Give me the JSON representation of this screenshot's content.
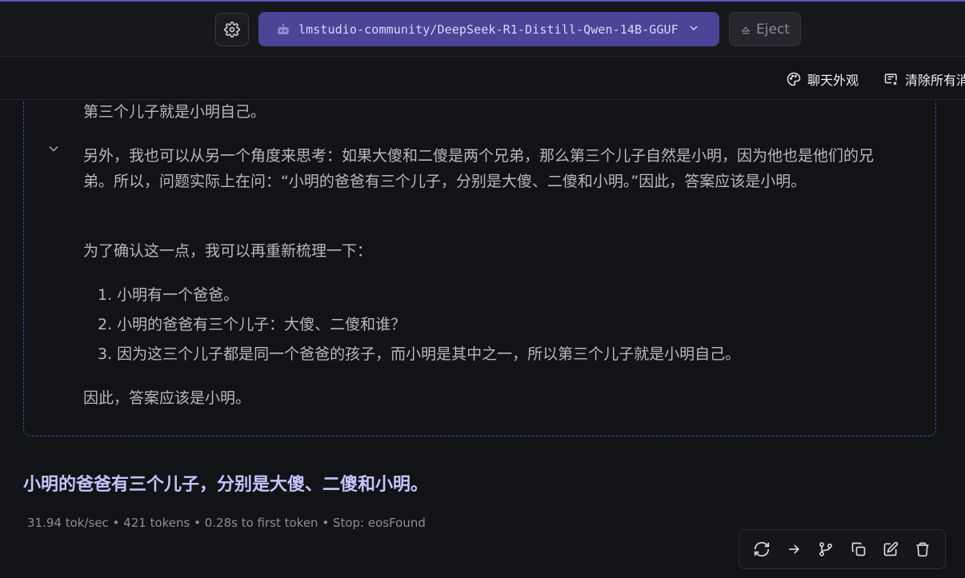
{
  "header": {
    "model_name": "lmstudio-community/DeepSeek-R1-Distill-Qwen-14B-GGUF",
    "eject_label": "Eject"
  },
  "toolbar": {
    "appearance_label": "聊天外观",
    "clear_label": "清除所有消"
  },
  "thinking": {
    "partial_line": "第三个儿子就是小明自己。",
    "paragraph1": "另外，我也可以从另一个角度来思考：如果大傻和二傻是两个兄弟，那么第三个儿子自然是小明，因为他也是他们的兄弟。所以，问题实际上在问：“小明的爸爸有三个儿子，分别是大傻、二傻和小明。”因此，答案应该是小明。",
    "paragraph2": "为了确认这一点，我可以再重新梳理一下：",
    "list": [
      "1. 小明有一个爸爸。",
      "2. 小明的爸爸有三个儿子：大傻、二傻和谁？",
      "3. 因为这三个儿子都是同一个爸爸的孩子，而小明是其中之一，所以第三个儿子就是小明自己。"
    ],
    "conclusion": "因此，答案应该是小明。"
  },
  "answer": "小明的爸爸有三个儿子，分别是大傻、二傻和小明。",
  "stats": "31.94 tok/sec • 421 tokens • 0.28s to first token • Stop: eosFound",
  "colors": {
    "accent": "#4a4597",
    "answer_text": "#c7c3ff",
    "background": "#121317"
  },
  "actions": [
    "regenerate-icon",
    "continue-icon",
    "branch-icon",
    "copy-icon",
    "edit-icon",
    "delete-icon"
  ]
}
